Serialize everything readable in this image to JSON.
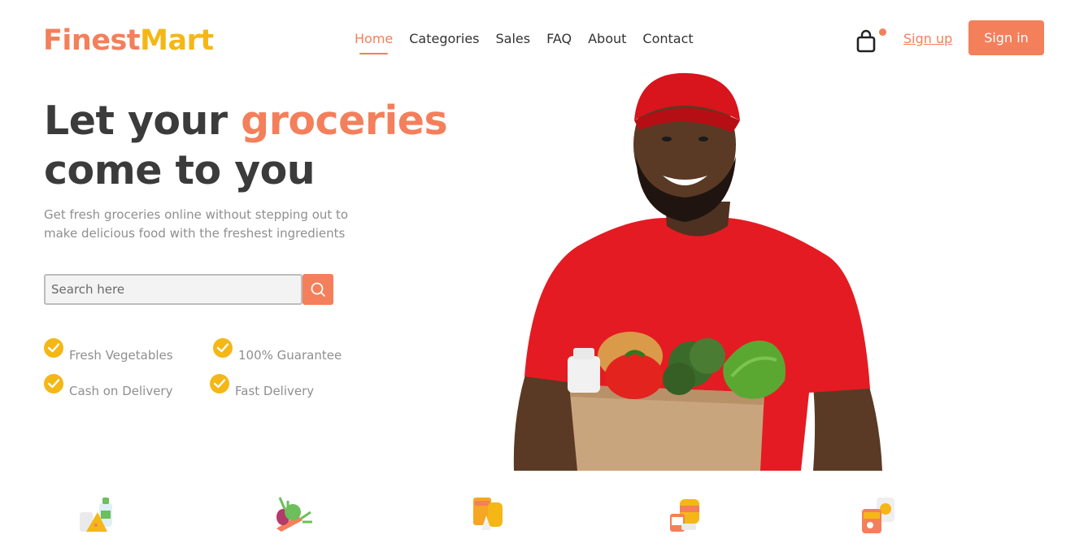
{
  "brand": {
    "part1": "Finest",
    "part2": "Mart"
  },
  "nav": {
    "items": [
      {
        "label": "Home",
        "active": true
      },
      {
        "label": "Categories"
      },
      {
        "label": "Sales"
      },
      {
        "label": "FAQ"
      },
      {
        "label": "About"
      },
      {
        "label": "Contact"
      }
    ]
  },
  "header": {
    "cart_icon": "shopping-bag-icon",
    "signup_label": "Sign up",
    "signin_label": "Sign in"
  },
  "hero": {
    "title_pre": "Let your ",
    "title_accent": "groceries",
    "title_post": "come to you",
    "subtitle": "Get fresh groceries online without stepping out to make delicious food with the freshest ingredients",
    "search_placeholder": "Search here",
    "features": [
      "Fresh Vegetables",
      "100% Guarantee",
      "Cash on Delivery",
      "Fast Delivery"
    ]
  },
  "categories": [
    {
      "icon": "dairy-icon"
    },
    {
      "icon": "vegetables-icon"
    },
    {
      "icon": "snacks-icon"
    },
    {
      "icon": "canned-food-icon"
    },
    {
      "icon": "packaged-food-icon"
    }
  ],
  "colors": {
    "accent": "#f47f5b",
    "yellow": "#f5b716",
    "text_dark": "#3b3b3b",
    "text_muted": "#8f8f8f"
  }
}
